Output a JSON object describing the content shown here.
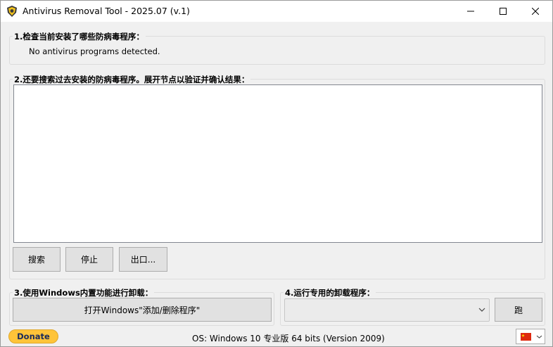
{
  "window": {
    "title": "Antivirus Removal Tool - 2025.07 (v.1)"
  },
  "section1": {
    "legend": "1.检查当前安装了哪些防病毒程序：",
    "status": "No antivirus programs detected."
  },
  "section2": {
    "legend": "2.还要搜索过去安装的防病毒程序。展开节点以验证并确认结果：",
    "search_label": "搜索",
    "stop_label": "停止",
    "export_label": "出口..."
  },
  "section3": {
    "legend": "3.使用Windows内置功能进行卸载：",
    "button_label": "打开Windows\"添加/删除程序\""
  },
  "section4": {
    "legend": "4.运行专用的卸载程序：",
    "select_value": "",
    "run_label": "跑"
  },
  "footer": {
    "donate_label": "Donate",
    "os_info": "OS: Windows 10 专业版 64 bits (Version 2009)",
    "language_flag": "CN"
  },
  "colors": {
    "donate_bg": "#ffc439",
    "flag": "#de2910"
  },
  "icons": {
    "app": "shield-icon",
    "minimize": "minimize-icon",
    "maximize": "maximize-icon",
    "close": "close-icon"
  }
}
